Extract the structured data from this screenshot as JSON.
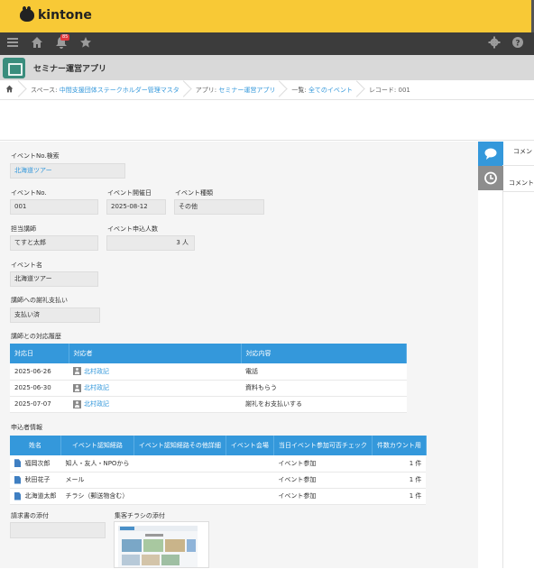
{
  "brand": {
    "name": "kintone"
  },
  "nav": {
    "icons": [
      "menu-icon",
      "home-icon",
      "bell-icon",
      "star-icon",
      "gear-icon",
      "help-icon"
    ],
    "notification_count": "85"
  },
  "app": {
    "title": "セミナー運営アプリ"
  },
  "breadcrumb": {
    "space_prefix": "スペース: ",
    "space": "中間支援団体ステークホルダー管理マスタ",
    "app_prefix": "アプリ: ",
    "app": "セミナー運営アプリ",
    "view_prefix": "一覧: ",
    "view": "全てのイベント",
    "record": "レコード: 001"
  },
  "side": {
    "comment_label_1": "コメン",
    "comment_label_2": "コメント"
  },
  "form": {
    "event_search": {
      "label": "イベントNo.検索",
      "value": "北海道ツアー"
    },
    "event_no": {
      "label": "イベントNo.",
      "value": "001"
    },
    "event_date": {
      "label": "イベント開催日",
      "value": "2025-08-12"
    },
    "event_type": {
      "label": "イベント種類",
      "value": "その他"
    },
    "instructor": {
      "label": "担当講師",
      "value": "てすと太郎"
    },
    "applicants": {
      "label": "イベント申込人数",
      "value": "3 人"
    },
    "event_name": {
      "label": "イベント名",
      "value": "北海道ツアー"
    },
    "payment": {
      "label": "講師への謝礼支払い",
      "value": "支払い済"
    },
    "history": {
      "label": "講師との対応履歴",
      "columns": [
        "対応日",
        "対応者",
        "対応内容"
      ],
      "rows": [
        {
          "date": "2025-06-26",
          "person": "北村政記",
          "content": "電話"
        },
        {
          "date": "2025-06-30",
          "person": "北村政記",
          "content": "資料もらう"
        },
        {
          "date": "2025-07-07",
          "person": "北村政記",
          "content": "謝礼をお支払いする"
        }
      ]
    },
    "applicants_info": {
      "label": "申込者情報",
      "columns": [
        "姓名",
        "イベント認知経路",
        "イベント認知経路その他詳細",
        "イベント会場",
        "当日イベント参加可否チェック",
        "件数カウント用"
      ],
      "rows": [
        {
          "name": "福岡次郎",
          "route": "知人・友人・NPOから",
          "detail": "",
          "venue": "",
          "check": "イベント参加",
          "count": "1 件"
        },
        {
          "name": "秋田花子",
          "route": "メール",
          "detail": "",
          "venue": "",
          "check": "イベント参加",
          "count": "1 件"
        },
        {
          "name": "北海道太郎",
          "route": "チラシ（郵送物含む）",
          "detail": "",
          "venue": "",
          "check": "イベント参加",
          "count": "1 件"
        }
      ]
    },
    "invoice": {
      "label": "請求書の添付"
    },
    "flyer": {
      "label": "集客チラシの添付"
    }
  }
}
